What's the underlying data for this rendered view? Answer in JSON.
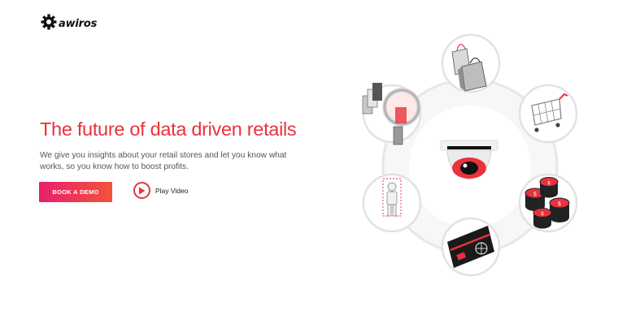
{
  "brand": {
    "name": "awiros"
  },
  "hero": {
    "headline": "The future of data driven retails",
    "subline": "We give you insights about your retail stores and let you know what works, so you know how to boost profits.",
    "primary_button": "BOOK A DEMO",
    "video_link": "Play Video"
  },
  "illustration": {
    "center": "camera-icon",
    "items": [
      "shopping-bags-icon",
      "shopping-cart-icon",
      "coins-icon",
      "credit-card-icon",
      "person-detection-icon",
      "magnifier-products-icon"
    ],
    "coin_symbol": "$"
  },
  "colors": {
    "accent": "#e8323c",
    "gradient_start": "#e71f6c",
    "gradient_end": "#f2533a"
  }
}
